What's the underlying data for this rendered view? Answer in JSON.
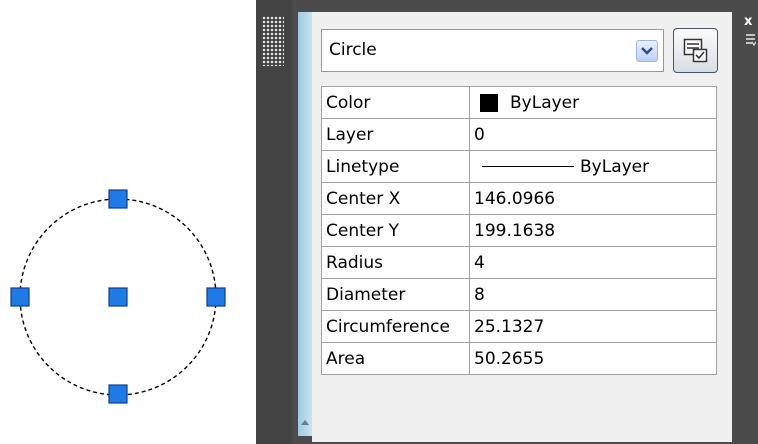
{
  "object_selector": {
    "value": "Circle"
  },
  "properties": [
    {
      "label": "Color",
      "value": "ByLayer",
      "kind": "color",
      "swatch_color": "#000000"
    },
    {
      "label": "Layer",
      "value": "0",
      "kind": "text"
    },
    {
      "label": "Linetype",
      "value": "ByLayer",
      "kind": "linetype"
    },
    {
      "label": "Center X",
      "value": "146.0966",
      "kind": "text"
    },
    {
      "label": "Center Y",
      "value": "199.1638",
      "kind": "text"
    },
    {
      "label": "Radius",
      "value": "4",
      "kind": "text"
    },
    {
      "label": "Diameter",
      "value": "8",
      "kind": "text"
    },
    {
      "label": "Circumference",
      "value": "25.1327",
      "kind": "text"
    },
    {
      "label": "Area",
      "value": "50.2655",
      "kind": "text"
    }
  ],
  "palette": {
    "close_glyph": "x"
  },
  "colors": {
    "grip_fill": "#1e7be6",
    "grip_stroke": "#0b3f8e",
    "palette_bg": "#4b4b4b",
    "panel_bg": "#f0f0f0",
    "side_bar": "#b5d8ec"
  },
  "icons": {
    "dropdown": "chevron-down-icon",
    "quick_select": "quick-select-icon",
    "close": "close-icon",
    "menu": "properties-menu-icon",
    "grip": "palette-grip-icon"
  }
}
